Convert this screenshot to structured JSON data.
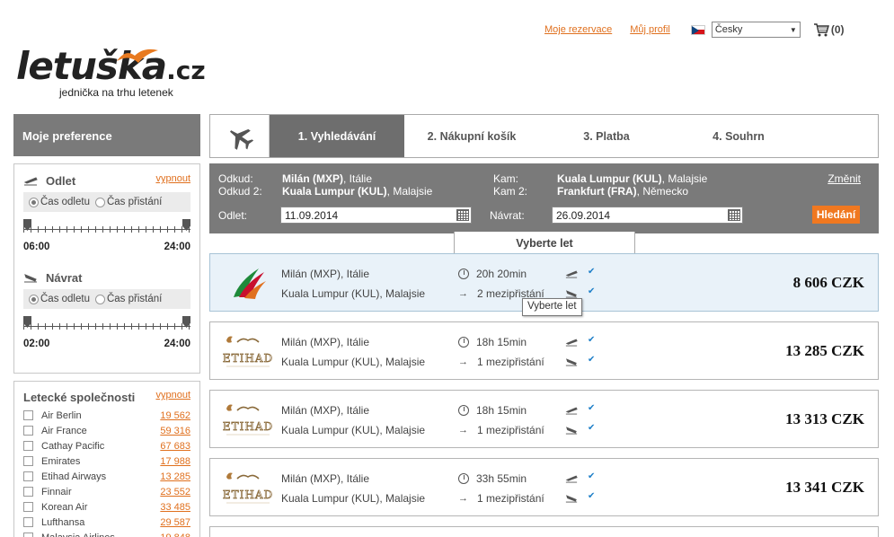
{
  "topnav": {
    "my_bookings": "Moje rezervace",
    "my_profile": "Můj profil",
    "language": "Česky",
    "cart_count": "(0)"
  },
  "logo": {
    "name": "letuška",
    "tld": ".cz",
    "tagline": "jednička na trhu letenek"
  },
  "sidebar": {
    "header": "Moje preference",
    "outbound": {
      "title": "Odlet",
      "toggle": "vypnout",
      "radio_departure": "Čas odletu",
      "radio_arrival": "Čas přistání",
      "time_min": "06:00",
      "time_max": "24:00"
    },
    "return": {
      "title": "Návrat",
      "radio_departure": "Čas odletu",
      "radio_arrival": "Čas přistání",
      "time_min": "02:00",
      "time_max": "24:00"
    },
    "airlines": {
      "title": "Letecké společnosti",
      "toggle": "vypnout",
      "items": [
        {
          "name": "Air Berlin",
          "price": "19 562"
        },
        {
          "name": "Air France",
          "price": "59 316"
        },
        {
          "name": "Cathay Pacific",
          "price": "67 683"
        },
        {
          "name": "Emirates",
          "price": "17 988"
        },
        {
          "name": "Etihad Airways",
          "price": "13 285"
        },
        {
          "name": "Finnair",
          "price": "23 552"
        },
        {
          "name": "Korean Air",
          "price": "33 485"
        },
        {
          "name": "Lufthansa",
          "price": "29 587"
        },
        {
          "name": "Malaysia Airlines",
          "price": "19 848"
        }
      ]
    }
  },
  "steps": [
    {
      "label": "1. Vyhledávání"
    },
    {
      "label": "2. Nákupní košík"
    },
    {
      "label": "3. Platba"
    },
    {
      "label": "4. Souhrn"
    }
  ],
  "search": {
    "from_label": "Odkud:",
    "from_city": "Milán (MXP)",
    "from_country": ", Itálie",
    "from2_label": "Odkud 2:",
    "from2_city": "Kuala Lumpur (KUL)",
    "from2_country": ", Malajsie",
    "to_label": "Kam:",
    "to_city": "Kuala Lumpur (KUL)",
    "to_country": ", Malajsie",
    "to2_label": "Kam 2:",
    "to2_city": "Frankfurt (FRA)",
    "to2_country": ", Německo",
    "change": "Změnit",
    "depart_label": "Odlet:",
    "depart_date": "11.09.2014",
    "return_label": "Návrat:",
    "return_date": "26.09.2014",
    "search_button": "Hledání"
  },
  "select_tab": "Vyberte let",
  "tooltip": "Vyberte let",
  "flights": [
    {
      "airline": "SriLankan",
      "origin": "Milán (MXP), Itálie",
      "destination": "Kuala Lumpur (KUL), Malajsie",
      "duration": "20h 20min",
      "stops": "2 mezipřistání",
      "price": "8 606 CZK"
    },
    {
      "airline": "Etihad",
      "origin": "Milán (MXP), Itálie",
      "destination": "Kuala Lumpur (KUL), Malajsie",
      "duration": "18h 15min",
      "stops": "1 mezipřistání",
      "price": "13 285 CZK"
    },
    {
      "airline": "Etihad",
      "origin": "Milán (MXP), Itálie",
      "destination": "Kuala Lumpur (KUL), Malajsie",
      "duration": "18h 15min",
      "stops": "1 mezipřistání",
      "price": "13 313 CZK"
    },
    {
      "airline": "Etihad",
      "origin": "Milán (MXP), Itálie",
      "destination": "Kuala Lumpur (KUL), Malajsie",
      "duration": "33h 55min",
      "stops": "1 mezipřistání",
      "price": "13 341 CZK"
    }
  ],
  "etihad_logo_text": "ETIHAD",
  "colors": {
    "accent": "#e0701e",
    "header_gray": "#7a7a7a",
    "selected": "#e9f2f9",
    "check": "#1e7fc8"
  }
}
